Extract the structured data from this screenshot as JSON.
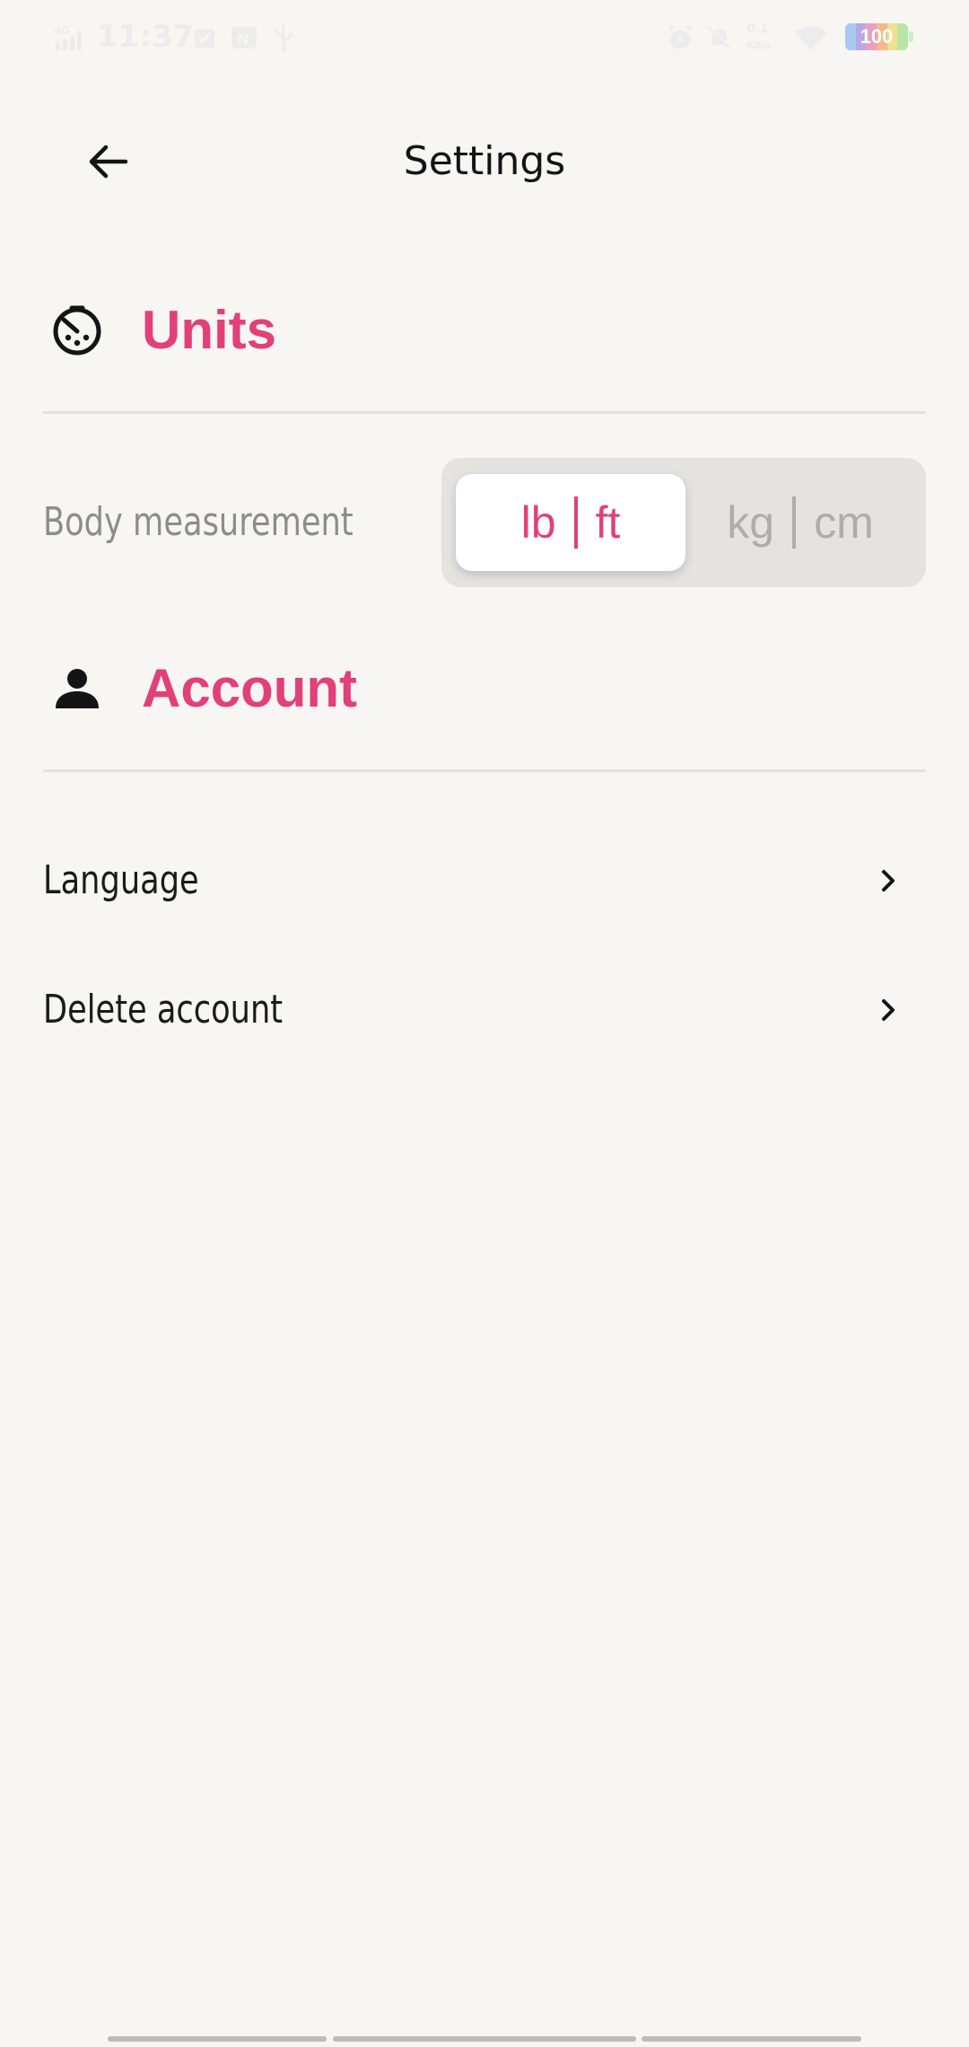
{
  "status_bar": {
    "time": "11:37",
    "battery_level": "100",
    "icons": [
      "signal-4g-icon",
      "notification-icon",
      "notification-icon",
      "usb-icon",
      "alarm-icon",
      "mute-icon",
      "network-speed-icon",
      "wifi-icon",
      "battery-icon"
    ]
  },
  "header": {
    "title": "Settings",
    "back_icon": "arrow-left-icon"
  },
  "units_section": {
    "title": "Units",
    "icon": "speedometer-icon",
    "body_measurement": {
      "label": "Body measurement",
      "options": [
        {
          "left": "lb",
          "right": "ft",
          "selected": true
        },
        {
          "left": "kg",
          "right": "cm",
          "selected": false
        }
      ]
    }
  },
  "account_section": {
    "title": "Account",
    "icon": "person-icon",
    "items": [
      {
        "label": "Language"
      },
      {
        "label": "Delete account"
      }
    ]
  },
  "colors": {
    "accent": "#e2407a",
    "background": "#f7f6f2",
    "divider": "#e2e1dd"
  }
}
